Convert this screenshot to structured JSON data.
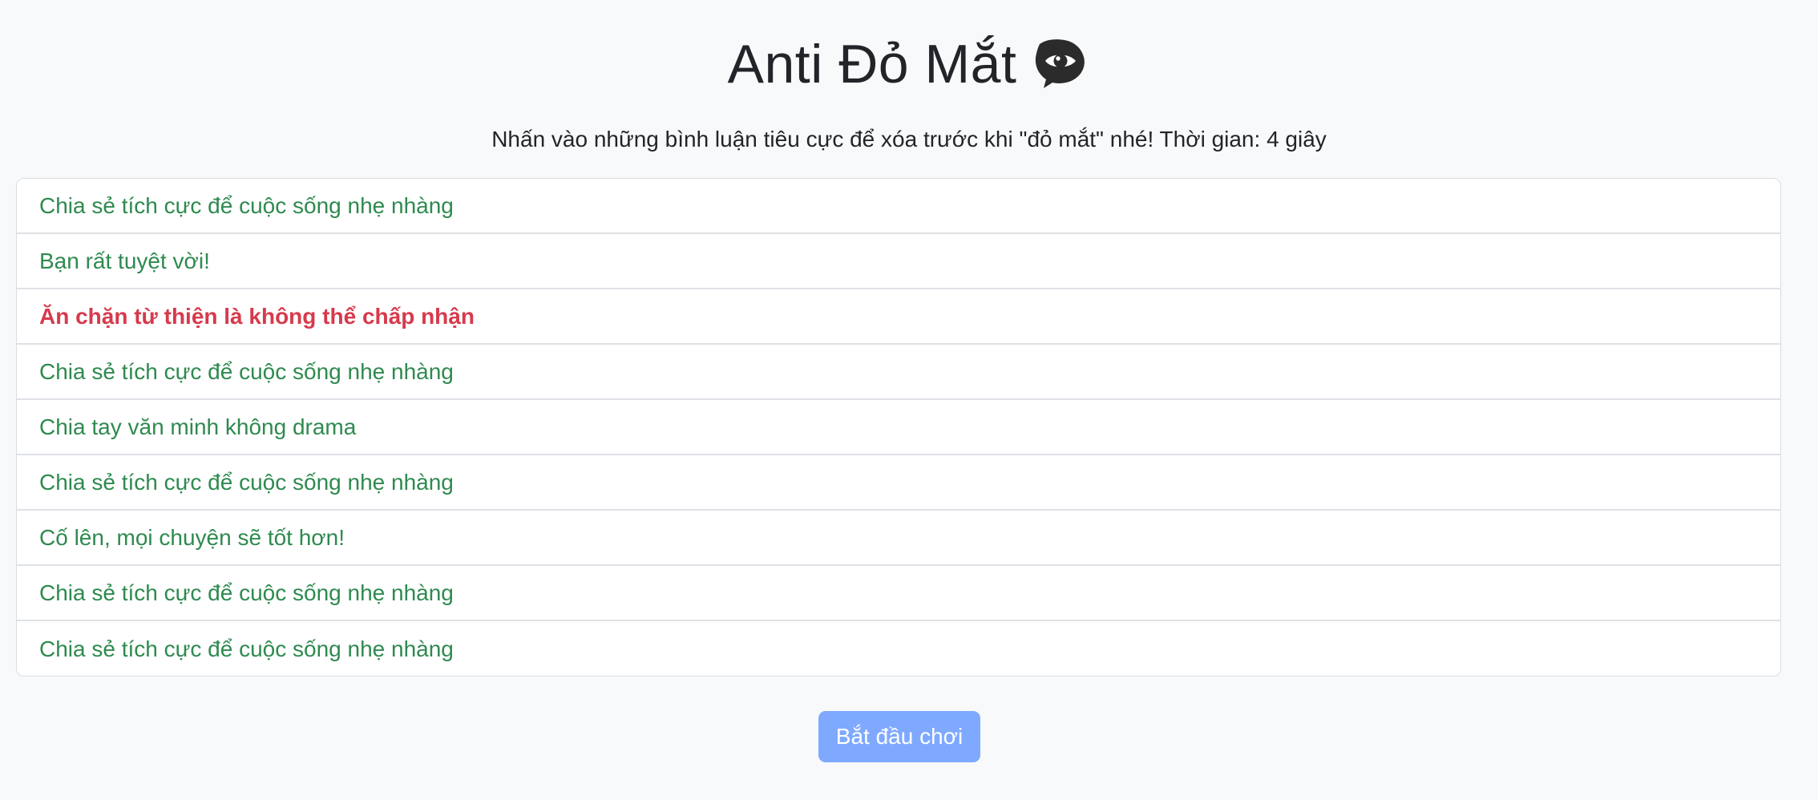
{
  "page": {
    "title": "Anti Đỏ Mắt",
    "title_icon": "eye-in-speech-bubble-icon",
    "instruction": "Nhấn vào những bình luận tiêu cực để xóa trước khi \"đỏ mắt\" nhé! Thời gian: 4 giây"
  },
  "comments": [
    {
      "text": "Chia sẻ tích cực để cuộc sống nhẹ nhàng",
      "sentiment": "positive"
    },
    {
      "text": "Bạn rất tuyệt vời!",
      "sentiment": "positive"
    },
    {
      "text": "Ăn chặn từ thiện là không thể chấp nhận",
      "sentiment": "negative"
    },
    {
      "text": "Chia sẻ tích cực để cuộc sống nhẹ nhàng",
      "sentiment": "positive"
    },
    {
      "text": "Chia tay văn minh không drama",
      "sentiment": "positive"
    },
    {
      "text": "Chia sẻ tích cực để cuộc sống nhẹ nhàng",
      "sentiment": "positive"
    },
    {
      "text": "Cố lên, mọi chuyện sẽ tốt hơn!",
      "sentiment": "positive"
    },
    {
      "text": "Chia sẻ tích cực để cuộc sống nhẹ nhàng",
      "sentiment": "positive"
    },
    {
      "text": "Chia sẻ tích cực để cuộc sống nhẹ nhàng",
      "sentiment": "positive"
    }
  ],
  "button": {
    "start_label": "Bắt đầu chơi"
  },
  "colors": {
    "background": "#f8f9fa",
    "positive_text": "#2e8a4f",
    "negative_text": "#d63a4c",
    "button_background": "#7ea9ff"
  }
}
